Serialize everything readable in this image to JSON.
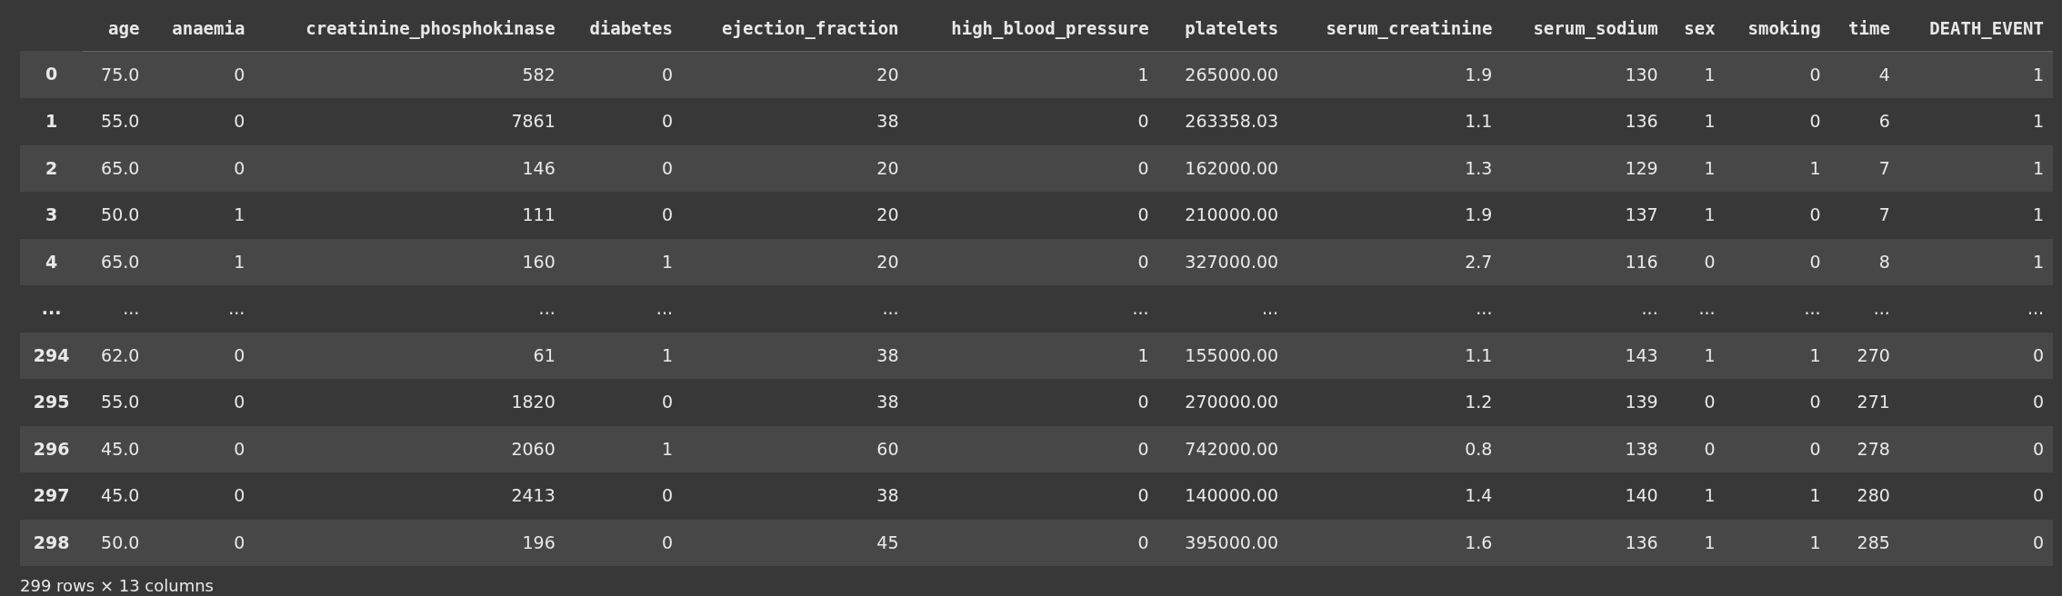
{
  "table": {
    "columns": [
      "age",
      "anaemia",
      "creatinine_phosphokinase",
      "diabetes",
      "ejection_fraction",
      "high_blood_pressure",
      "platelets",
      "serum_creatinine",
      "serum_sodium",
      "sex",
      "smoking",
      "time",
      "DEATH_EVENT"
    ],
    "rows": [
      {
        "index": "0",
        "cells": [
          "75.0",
          "0",
          "582",
          "0",
          "20",
          "1",
          "265000.00",
          "1.9",
          "130",
          "1",
          "0",
          "4",
          "1"
        ]
      },
      {
        "index": "1",
        "cells": [
          "55.0",
          "0",
          "7861",
          "0",
          "38",
          "0",
          "263358.03",
          "1.1",
          "136",
          "1",
          "0",
          "6",
          "1"
        ]
      },
      {
        "index": "2",
        "cells": [
          "65.0",
          "0",
          "146",
          "0",
          "20",
          "0",
          "162000.00",
          "1.3",
          "129",
          "1",
          "1",
          "7",
          "1"
        ]
      },
      {
        "index": "3",
        "cells": [
          "50.0",
          "1",
          "111",
          "0",
          "20",
          "0",
          "210000.00",
          "1.9",
          "137",
          "1",
          "0",
          "7",
          "1"
        ]
      },
      {
        "index": "4",
        "cells": [
          "65.0",
          "1",
          "160",
          "1",
          "20",
          "0",
          "327000.00",
          "2.7",
          "116",
          "0",
          "0",
          "8",
          "1"
        ]
      },
      {
        "index": "...",
        "cells": [
          "...",
          "...",
          "...",
          "...",
          "...",
          "...",
          "...",
          "...",
          "...",
          "...",
          "...",
          "...",
          "..."
        ]
      },
      {
        "index": "294",
        "cells": [
          "62.0",
          "0",
          "61",
          "1",
          "38",
          "1",
          "155000.00",
          "1.1",
          "143",
          "1",
          "1",
          "270",
          "0"
        ]
      },
      {
        "index": "295",
        "cells": [
          "55.0",
          "0",
          "1820",
          "0",
          "38",
          "0",
          "270000.00",
          "1.2",
          "139",
          "0",
          "0",
          "271",
          "0"
        ]
      },
      {
        "index": "296",
        "cells": [
          "45.0",
          "0",
          "2060",
          "1",
          "60",
          "0",
          "742000.00",
          "0.8",
          "138",
          "0",
          "0",
          "278",
          "0"
        ]
      },
      {
        "index": "297",
        "cells": [
          "45.0",
          "0",
          "2413",
          "0",
          "38",
          "0",
          "140000.00",
          "1.4",
          "140",
          "1",
          "1",
          "280",
          "0"
        ]
      },
      {
        "index": "298",
        "cells": [
          "50.0",
          "0",
          "196",
          "0",
          "45",
          "0",
          "395000.00",
          "1.6",
          "136",
          "1",
          "1",
          "285",
          "0"
        ]
      }
    ]
  },
  "footer": "299 rows × 13 columns"
}
